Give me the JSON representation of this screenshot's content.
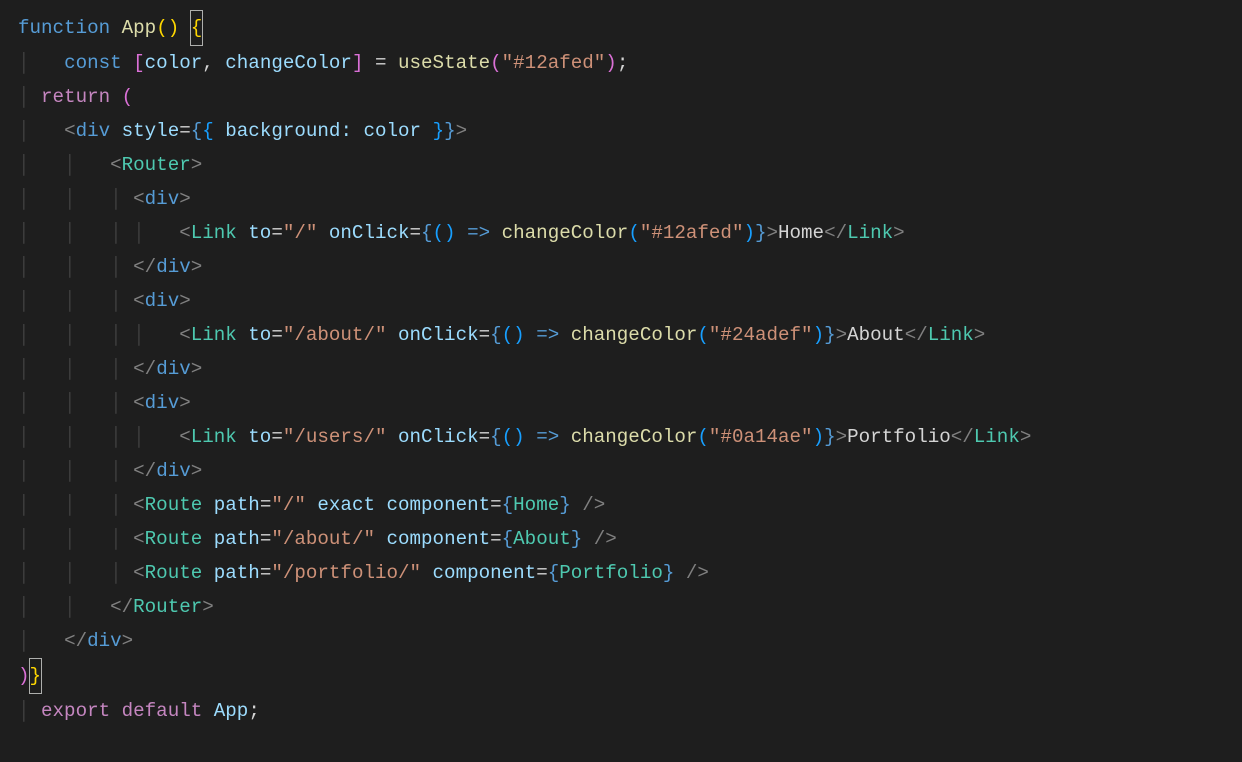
{
  "code": {
    "l1_function": "function",
    "l1_App": "App",
    "l2_const": "const",
    "l2_color": "color",
    "l2_changeColor": "changeColor",
    "l2_useState": "useState",
    "l2_val": "\"#12afed\"",
    "l3_return": "return",
    "l4_div": "div",
    "l4_style": "style",
    "l4_background": "background",
    "l4_colorVar": "color",
    "l5_Router": "Router",
    "link": "Link",
    "to": "to",
    "onClick": "onClick",
    "l7_to": "\"/\"",
    "l7_color": "\"#12afed\"",
    "l7_text": "Home",
    "l10_to": "\"/about/\"",
    "l10_color": "\"#24adef\"",
    "l10_text": "About",
    "l13_to": "\"/users/\"",
    "l13_color": "\"#0a14ae\"",
    "l13_text": "Portfolio",
    "route": "Route",
    "path": "path",
    "exact": "exact",
    "component": "component",
    "r1_path": "\"/\"",
    "r1_comp": "Home",
    "r2_path": "\"/about/\"",
    "r2_comp": "About",
    "r3_path": "\"/portfolio/\"",
    "r3_comp": "Portfolio",
    "exp_export": "export",
    "exp_default": "default",
    "exp_App": "App"
  }
}
